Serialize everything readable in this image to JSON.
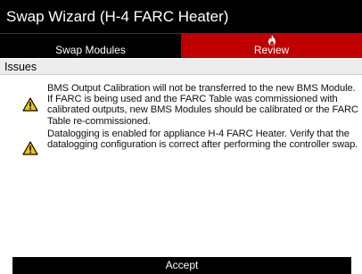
{
  "window": {
    "title": "Swap Wizard (H-4 FARC Heater)"
  },
  "tabs": [
    {
      "label": "Swap Modules",
      "active": false
    },
    {
      "label": "Review",
      "active": true,
      "icon": "flame-icon"
    }
  ],
  "section": {
    "title": "Issues"
  },
  "issues": [
    {
      "icon": "warning-icon",
      "text": "BMS Output Calibration will not be transferred to the new BMS Module. If FARC is being used and the FARC Table was commissioned with calibrated outputs, new BMS Modules should be calibrated or the FARC Table re-commissioned."
    },
    {
      "icon": "warning-icon",
      "text": "Datalogging is enabled for appliance H-4 FARC Heater. Verify that the datalogging configuration is correct after performing the controller swap."
    }
  ],
  "footer": {
    "accept_label": "Accept"
  },
  "colors": {
    "active_tab": "#c00000",
    "warning": "#f2c400",
    "bar": "#000000"
  }
}
